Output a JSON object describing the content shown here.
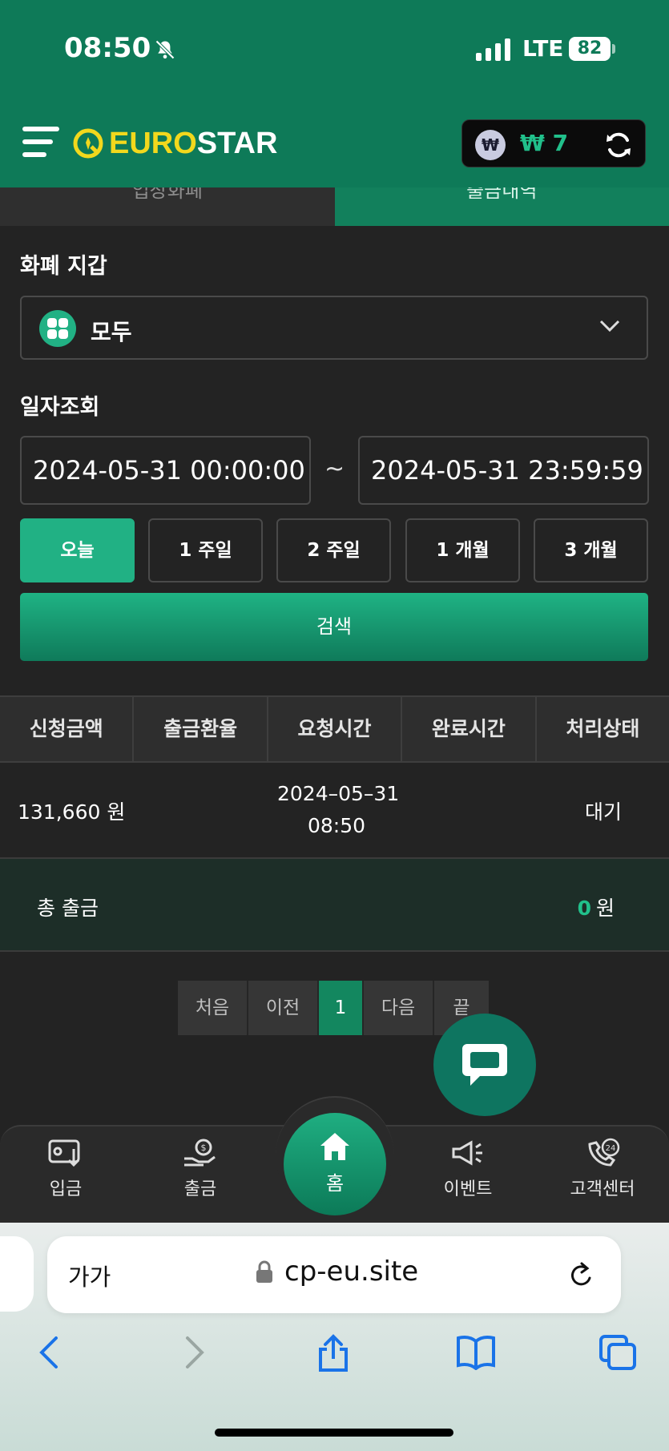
{
  "status": {
    "time": "08:50",
    "network": "LTE",
    "battery": "82"
  },
  "header": {
    "logo_part1": "EURO",
    "logo_part2": "STAR",
    "wallet_symbol": "₩",
    "wallet_amount": "₩ 7"
  },
  "tabs": [
    {
      "label": "입장화폐",
      "active": false
    },
    {
      "label": "출금내역",
      "active": true
    }
  ],
  "wallet_section": {
    "title": "화폐 지갑",
    "selected": "모두"
  },
  "date_section": {
    "title": "일자조회",
    "start": "2024-05-31 00:00:00",
    "separator": "~",
    "end": "2024-05-31 23:59:59"
  },
  "periods": [
    {
      "label": "오늘",
      "active": true
    },
    {
      "label": "1 주일",
      "active": false
    },
    {
      "label": "2 주일",
      "active": false
    },
    {
      "label": "1 개월",
      "active": false
    },
    {
      "label": "3 개월",
      "active": false
    }
  ],
  "search_label": "검색",
  "table": {
    "headers": [
      "신청금액",
      "출금환율",
      "요청시간",
      "완료시간",
      "처리상태"
    ],
    "rows": [
      {
        "amount": "131,660 원",
        "rate": "",
        "request_date": "2024–05–31",
        "request_time": "08:50",
        "complete": "",
        "status": "대기"
      }
    ]
  },
  "total": {
    "label": "총 출금",
    "value": "0",
    "unit": "원"
  },
  "pagination": {
    "first": "처음",
    "prev": "이전",
    "current": "1",
    "next": "다음",
    "last": "끝"
  },
  "bottom_nav": {
    "deposit": "입금",
    "withdraw": "출금",
    "home": "홈",
    "event": "이벤트",
    "support": "고객센터"
  },
  "browser": {
    "text_size": "가가",
    "url": "cp-eu.site"
  },
  "colors": {
    "brand_green": "#0e7a58",
    "accent": "#21b184",
    "logo_yellow": "#f2d81d"
  }
}
